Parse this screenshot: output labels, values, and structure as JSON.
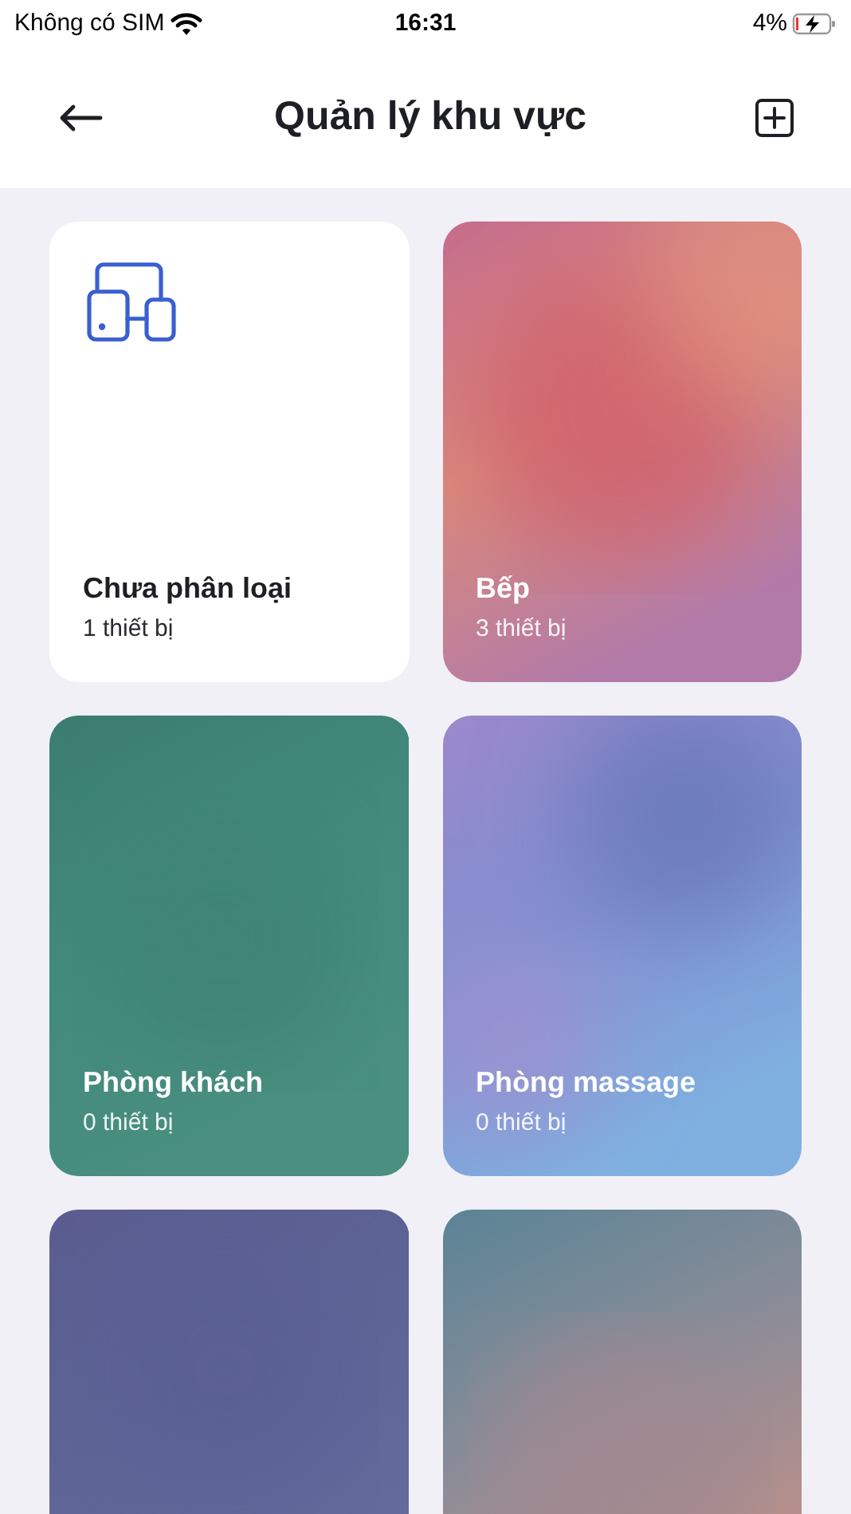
{
  "status_bar": {
    "carrier": "Không có SIM",
    "time": "16:31",
    "battery": "4%"
  },
  "header": {
    "title": "Quản lý khu vực"
  },
  "areas": [
    {
      "kind": "unassigned",
      "name": "Chưa phân loại",
      "count": "1 thiết bị"
    },
    {
      "kind": "picture",
      "name": "Bếp",
      "count": "3 thiết bị"
    },
    {
      "kind": "picture",
      "name": "Phòng khách",
      "count": "0 thiết bị"
    },
    {
      "kind": "picture",
      "name": "Phòng massage",
      "count": "0 thiết bị"
    },
    {
      "kind": "picture"
    },
    {
      "kind": "picture"
    }
  ]
}
